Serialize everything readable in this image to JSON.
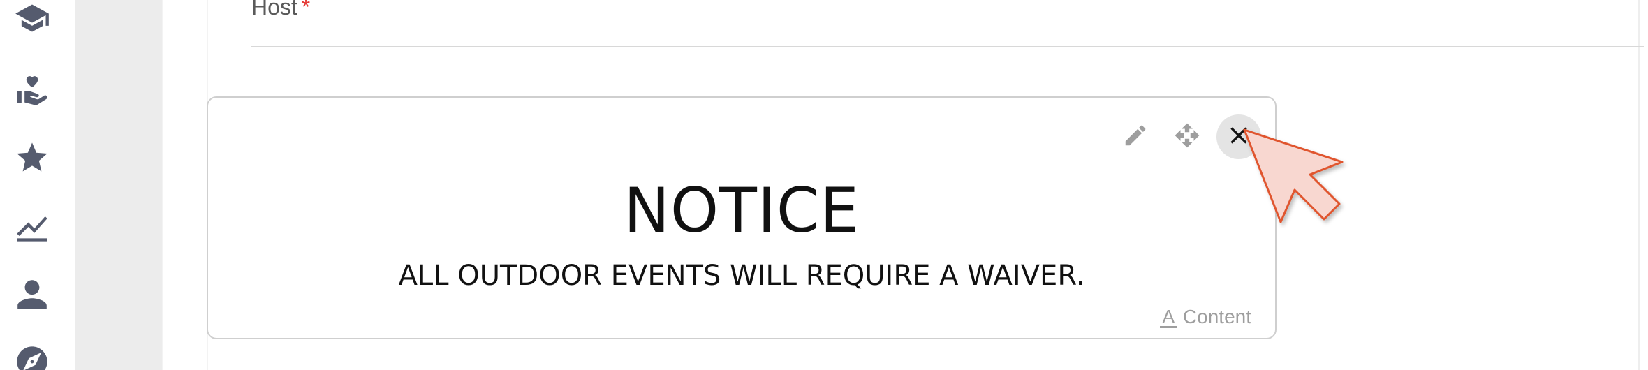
{
  "sidebar": {
    "icons": [
      "graduation-cap-icon",
      "hand-heart-icon",
      "star-icon",
      "chart-line-icon",
      "person-icon",
      "compass-icon"
    ]
  },
  "form": {
    "host_label": "Host",
    "required_marker": "*"
  },
  "notice_card": {
    "title": "NOTICE",
    "body": "ALL OUTDOOR EVENTS WILL REQUIRE A WAIVER.",
    "content_tag_icon": "A",
    "content_tag_label": "Content",
    "tools": [
      "pencil-icon",
      "move-icon",
      "close-icon"
    ]
  },
  "colors": {
    "icon_grey": "#555b6e",
    "gutter": "#ececec",
    "required": "#e53935",
    "cursor_fill": "#f8d7d0",
    "cursor_stroke": "#e0552f"
  }
}
